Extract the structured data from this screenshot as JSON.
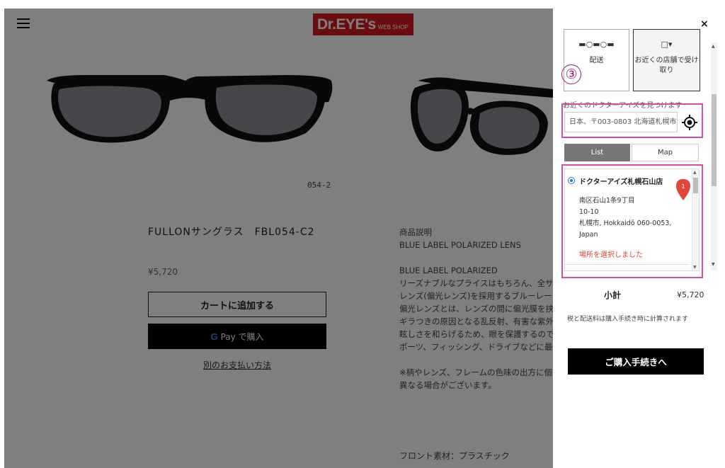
{
  "header": {
    "logo_main": "Dr.EYE's",
    "logo_sub": "WEB SHOP"
  },
  "gallery": {
    "caption": "054-2"
  },
  "product": {
    "title": "FULLONサングラス　FBL054-C2",
    "price": "¥5,720",
    "add_to_cart": "カートに追加する",
    "gpay_g": "G",
    "gpay_label": "Pay で購入",
    "alt_payment": "別のお支払い方法",
    "description": "商品説明\nBLUE LABEL POLARIZED LENS\n\nBLUE LABEL POLARIZED\nリーズナブルなプライスはもちろん、全サ\nレンズ(偏光レンズ)を採用するブルーレー\n偏光レンズとは、レンズの間に偏光膜を挟\nギラつきの原因となる乱反射、有害な紫外\n眩しさを和らげるため、眼を保護するので\nポーツ、フィッシング、ドライブなどに最\n\n※柄やレンズ、フレームの色味の出方に個\n異なる場合がございます。",
    "material": "フロント素材：プラスチック"
  },
  "drawer": {
    "close": "×",
    "options": [
      {
        "label": "配送",
        "icon_text": "▬○▬○▬"
      },
      {
        "label": "お近くの店舗で受け取り",
        "icon_text": "□▾"
      }
    ],
    "step_number": "③",
    "find_label": "お近くのドクターアイズを見つけます",
    "search_value": "日本、〒003-0803 北海道札幌市",
    "tabs": {
      "list": "List",
      "map": "Map"
    },
    "store": {
      "name": "ドクターアイズ札幌石山店",
      "address": "南区石山1条9丁目\n10-10\n札幌市, Hokkaidō 060-0053,\nJapan",
      "selected_text": "場所を選択しました",
      "pin_number": "1"
    },
    "subtotal_label": "小計",
    "subtotal_value": "¥5,720",
    "tax_note": "税と配送料は購入手続き時に計算されます",
    "checkout": "ご購入手続きへ"
  },
  "colors": {
    "brand_red": "#d71920",
    "highlight_magenta": "#cc4fa9",
    "selected_text_red": "#d2463a",
    "radio_blue": "#2a6fd6"
  }
}
